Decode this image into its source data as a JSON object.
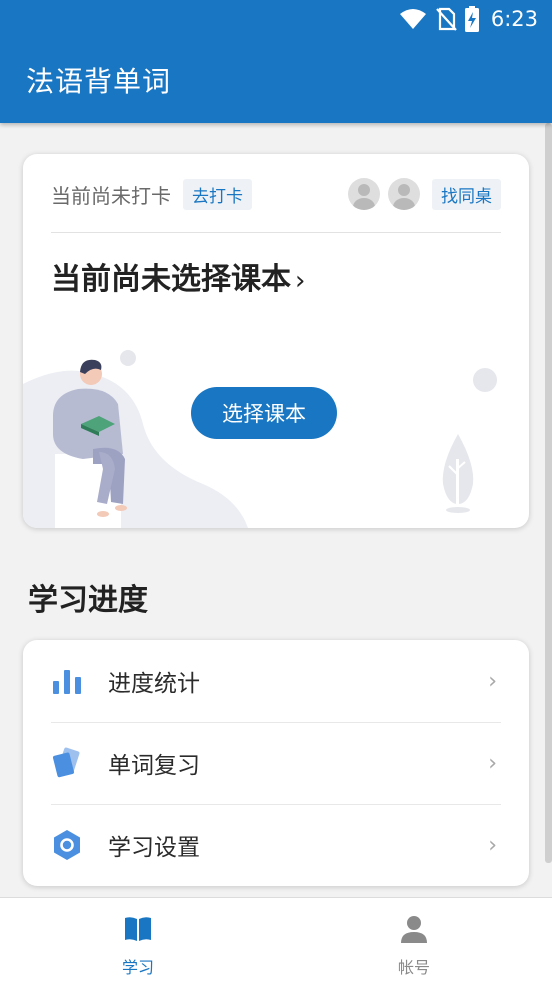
{
  "status_bar": {
    "time": "6:23",
    "icons": [
      "wifi-icon",
      "no-sim-icon",
      "battery-charging-icon"
    ]
  },
  "app_bar": {
    "title": "法语背单词"
  },
  "checkin_card": {
    "status_text": "当前尚未打卡",
    "checkin_button": "去打卡",
    "find_partner_button": "找同桌",
    "book_title": "当前尚未选择课本",
    "book_chevron": "›",
    "choose_book_button": "选择课本"
  },
  "progress_section": {
    "title": "学习进度",
    "items": [
      {
        "label": "进度统计",
        "icon": "bar-chart-icon",
        "chevron": "›"
      },
      {
        "label": "单词复习",
        "icon": "flashcards-icon",
        "chevron": "›"
      },
      {
        "label": "学习设置",
        "icon": "settings-hexagon-icon",
        "chevron": "›"
      }
    ]
  },
  "bottom_nav": {
    "tabs": [
      {
        "label": "学习",
        "icon": "book-icon",
        "active": true
      },
      {
        "label": "帐号",
        "icon": "person-icon",
        "active": false
      }
    ]
  },
  "colors": {
    "primary": "#1976c2",
    "icon_blue": "#4a8fe0",
    "inactive": "#8a8a8a",
    "background": "#f2f2f2"
  }
}
